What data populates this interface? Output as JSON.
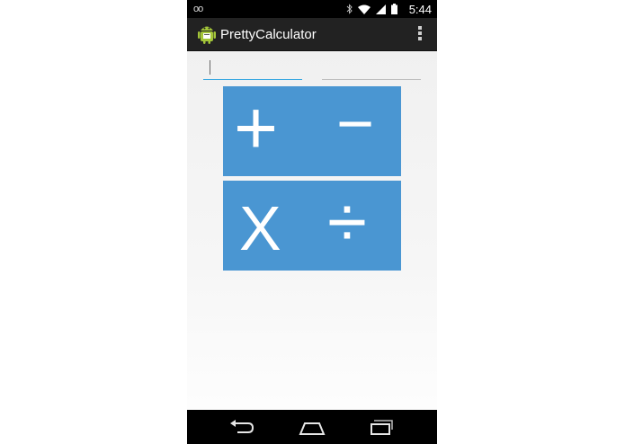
{
  "status_bar": {
    "voicemail_icon": "voicemail-icon",
    "bluetooth_icon": "bluetooth-icon",
    "wifi_icon": "wifi-icon",
    "signal_icon": "signal-icon",
    "battery_icon": "battery-icon",
    "time": "5:44"
  },
  "action_bar": {
    "app_icon": "android-icon",
    "title": "PrettyCalculator",
    "overflow_icon": "overflow-menu-icon"
  },
  "inputs": {
    "first_value": "",
    "second_value": ""
  },
  "buttons": {
    "add_symbol": "+",
    "subtract_symbol": "−",
    "multiply_symbol": "X",
    "divide_symbol": "÷"
  },
  "nav_bar": {
    "back_icon": "back-icon",
    "home_icon": "home-icon",
    "recents_icon": "recents-icon"
  },
  "colors": {
    "button_blue": "#4a96d2",
    "action_bar": "#222222",
    "input_focus": "#33a5e0"
  }
}
